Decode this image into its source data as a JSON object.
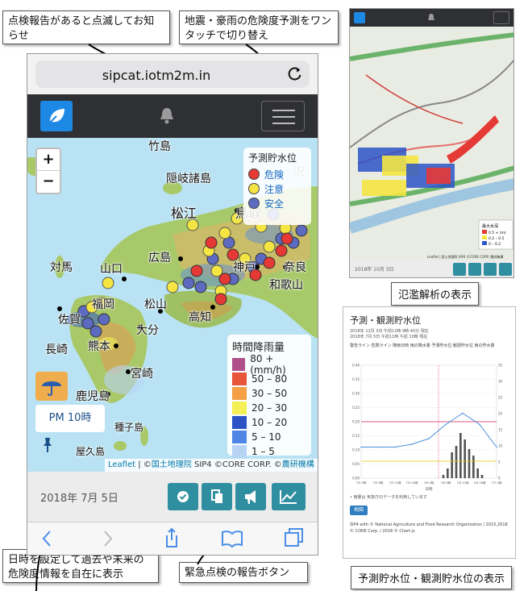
{
  "callouts": {
    "top_left": "点検報告があると点滅してお知らせ",
    "top_mid": "地震・豪雨の危険度予測をワンタッチで切り替え",
    "bottom_left": "日時を設定して過去や未来の危険度情報を自在に表示",
    "bottom_mid": "緊急点検の報告ボタン"
  },
  "captions": {
    "flood": "氾濫解析の表示",
    "water": "予測貯水位・観測貯水位の表示"
  },
  "browser": {
    "url": "sipcat.iotm2m.in"
  },
  "map": {
    "zoom_in": "+",
    "zoom_out": "−",
    "legend_storage": {
      "title": "予測貯水位",
      "items": [
        {
          "label": "危険",
          "color": "#e53935"
        },
        {
          "label": "注意",
          "color": "#f4e542"
        },
        {
          "label": "安全",
          "color": "#5c6bc0"
        }
      ]
    },
    "legend_rain": {
      "title": "時間降雨量",
      "items": [
        {
          "label": "80 + (mm/h)",
          "color": "#b0508a"
        },
        {
          "label": "50 – 80",
          "color": "#e8563a"
        },
        {
          "label": "30 – 50",
          "color": "#f5a044"
        },
        {
          "label": "20 – 30",
          "color": "#f3ef55"
        },
        {
          "label": "10 – 20",
          "color": "#2c54c7"
        },
        {
          "label": "5 – 10",
          "color": "#4f86e6"
        },
        {
          "label": "1 – 5",
          "color": "#b8d4f5"
        }
      ]
    },
    "place_labels": [
      "竹島",
      "隠岐諸島",
      "松江",
      "鳥取",
      "対馬",
      "山口",
      "広島",
      "神戸",
      "奈良",
      "和歌山",
      "松山",
      "高知",
      "大分",
      "熊本",
      "長崎",
      "佐賀",
      "福岡",
      "宮崎",
      "鹿児島",
      "種子島",
      "屋久島",
      "沢"
    ],
    "time_label": "PM 10時",
    "attribution": {
      "leaflet": "Leaflet",
      "sep": " | ©",
      "gsi": "国土地理院",
      "mid": " SIP4 ©CORE CORP. ©",
      "lab": "農研機構"
    }
  },
  "bottom": {
    "date": "2018年 7月 5日"
  },
  "flood_panel": {
    "legend_title": "最大水深",
    "legend_items": [
      "0.5 + (m)",
      "0.2 – 0.5",
      "0 – 0.2"
    ],
    "attribution": "Leaflet | 国土地理院 SIP4 ©CORE CORP. 農研機構",
    "date": "2018年 10月 3日"
  },
  "water_panel": {
    "title": "予測・観測貯水位",
    "sub1": "2018年 12月 3日 午前11時 9時 40分 現在",
    "sub2": "2018年 7月 5日 午前11時 午前 10時 現在",
    "legend": "警告ライン  危険ライン  降雨日時  雨の降水量  予測貯水位  観測貯水位  雨の貯水量",
    "note": "• 雨量は 気象庁のデータを利用しています",
    "button": "地図",
    "footer": "SIP4 with © National Agriculture and Food Research Organization / 2015,2018 © CORE Corp. / 2018 © Chart.js"
  },
  "chart_data": {
    "type": "line",
    "title": "予測・観測貯水位",
    "x": [
      "7/5 0時",
      "7/5 6時",
      "7/5 12時",
      "7/5 18時",
      "7/6 0時",
      "7/6 6時",
      "7/6 12時",
      "7/6 18時",
      "7/7 0時"
    ],
    "series": [
      {
        "values": [
          0.11,
          0.11,
          0.11,
          0.12,
          0.14,
          0.19,
          0.23,
          0.19,
          0.11
        ]
      }
    ],
    "bars": [
      0,
      0,
      0,
      0,
      1,
      3,
      8,
      10,
      14,
      12,
      9,
      7,
      3,
      1,
      0
    ],
    "ylim": [
      0,
      0.4
    ],
    "y2lim": [
      0,
      35
    ],
    "warning_line": 0.2,
    "danger_line": 0.06,
    "xlabel": "日時"
  },
  "colors": {
    "navbar": "#2f3033",
    "brand": "#1e88e5",
    "button": "#2f8fa0",
    "timebutton": "#f0ad4e"
  }
}
